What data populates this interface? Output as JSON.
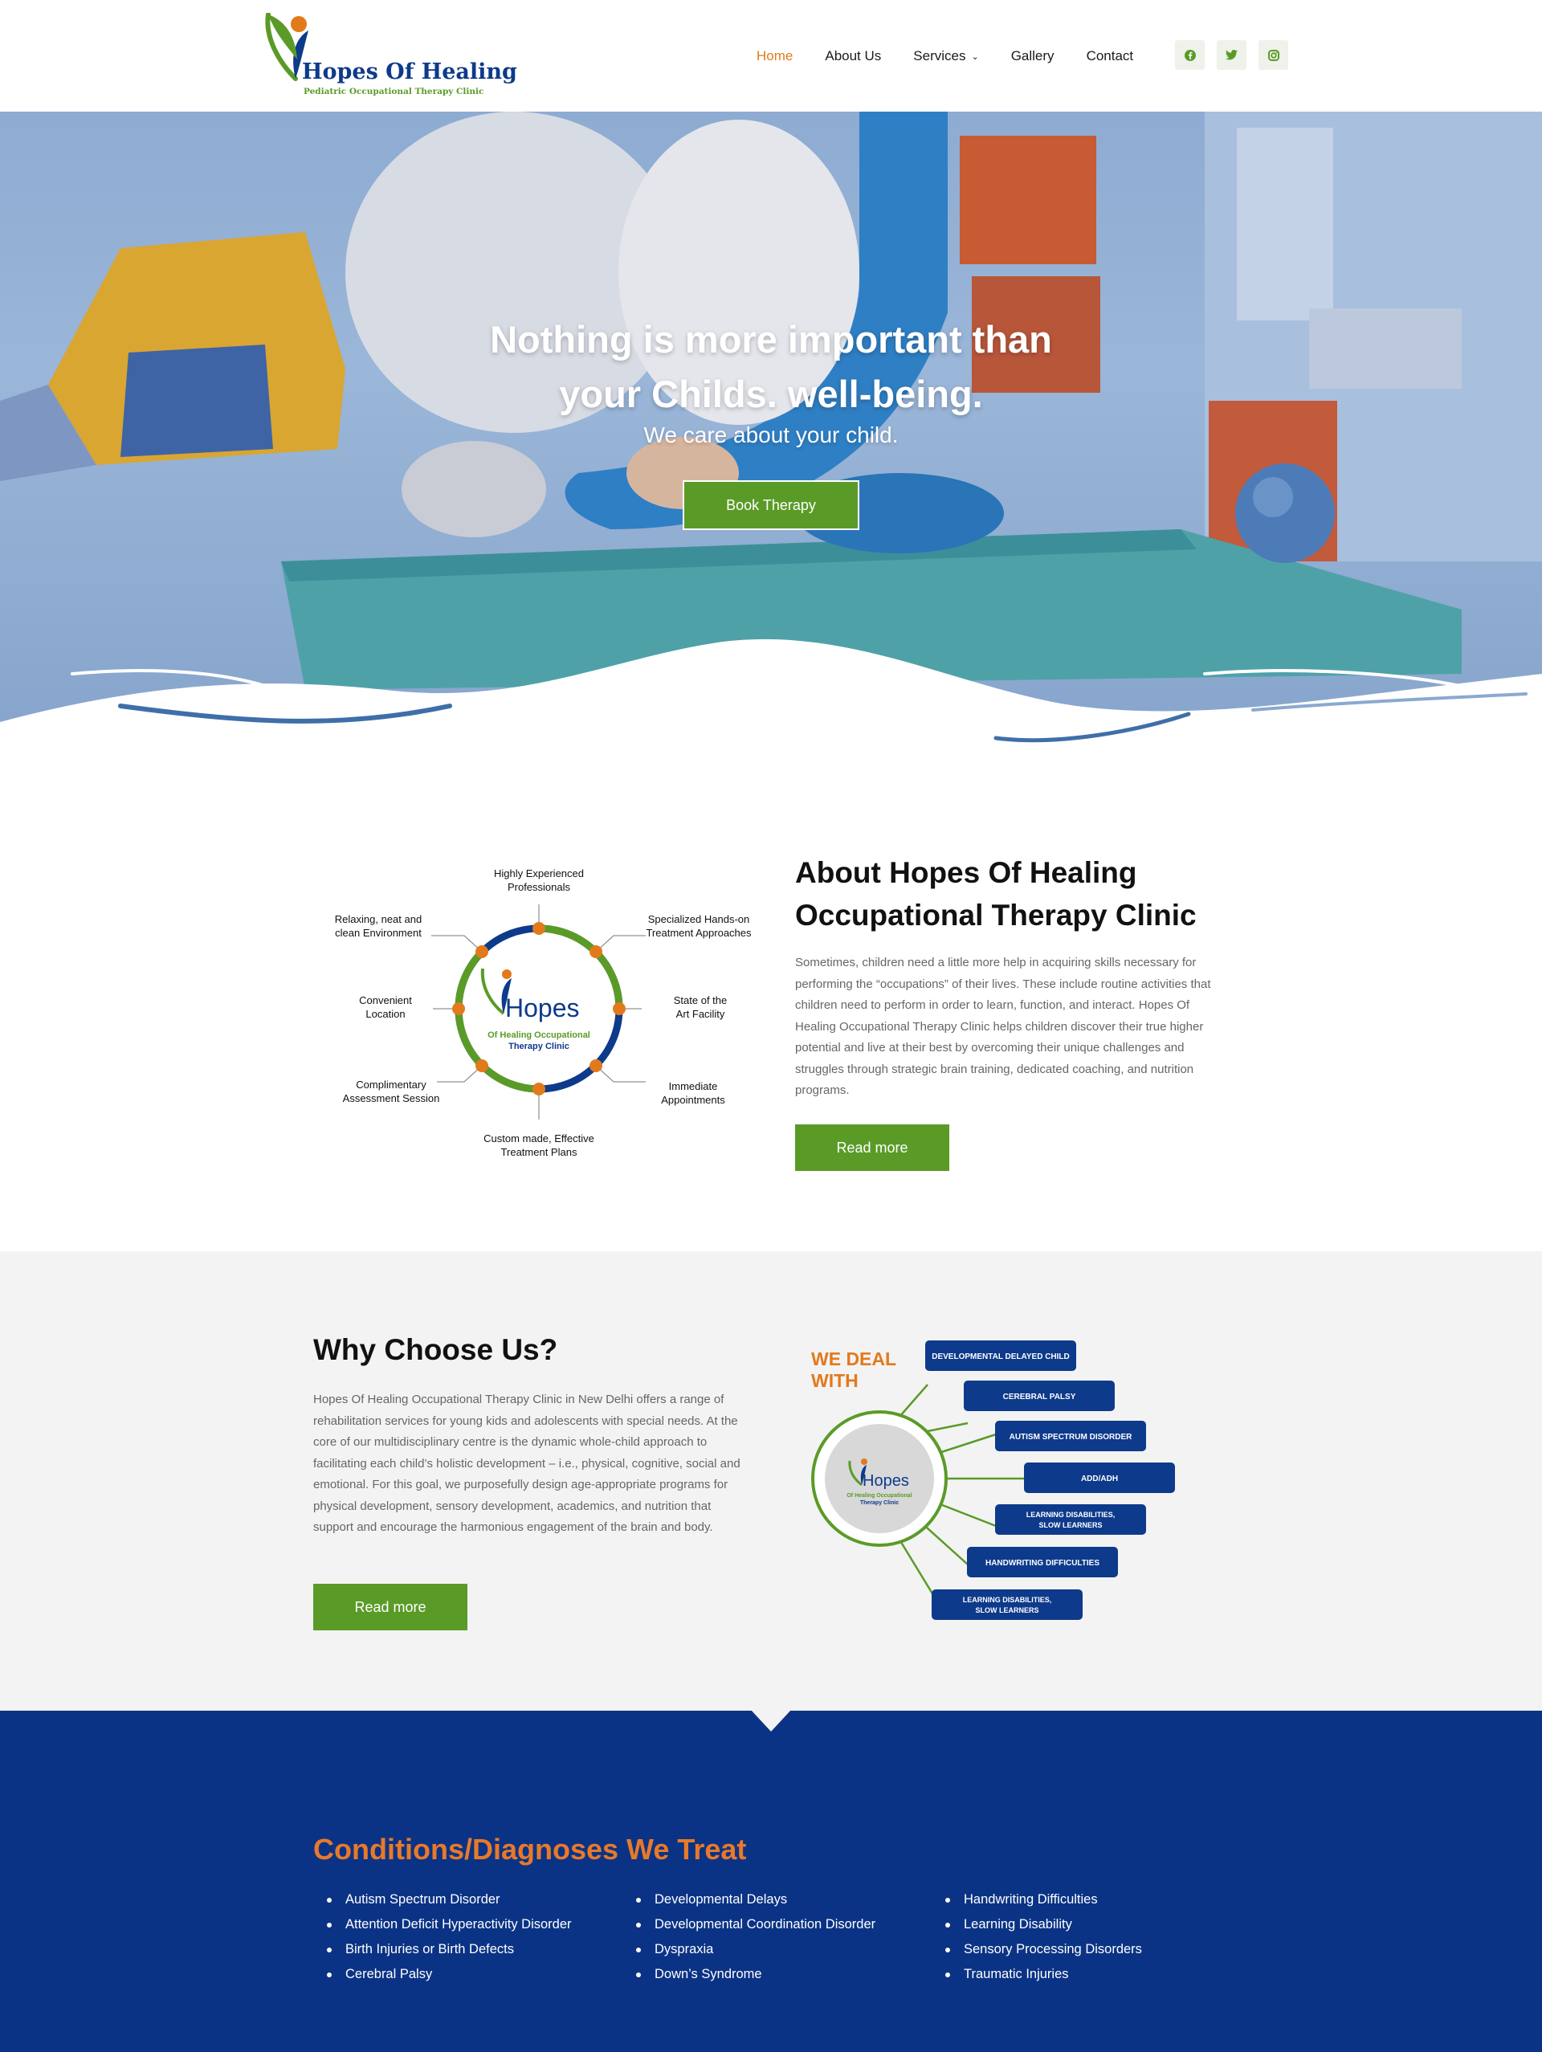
{
  "brand": {
    "name": "Hopes Of Healing",
    "tagline": "Pediatric Occupational Therapy Clinic"
  },
  "nav": {
    "items": [
      {
        "label": "Home",
        "active": true
      },
      {
        "label": "About Us"
      },
      {
        "label": "Services",
        "has_dropdown": true
      },
      {
        "label": "Gallery"
      },
      {
        "label": "Contact"
      }
    ],
    "social": [
      "facebook-icon",
      "twitter-icon",
      "instagram-icon"
    ]
  },
  "hero": {
    "title_line1": "Nothing is more important than",
    "title_line2": "your Childs. well-being.",
    "subtitle": "We care about your child.",
    "button": "Book Therapy"
  },
  "about": {
    "title_line1": "About Hopes Of Healing",
    "title_line2": "Occupational Therapy Clinic",
    "body": "Sometimes, children need a little more help in acquiring skills necessary for performing the “occupations” of their lives. These include routine activities that children need to perform in order to learn, function, and interact. Hopes Of Healing Occupational Therapy Clinic helps children discover their true higher potential and live at their best by overcoming their unique challenges and struggles through strategic brain training, dedicated coaching, and nutrition programs.",
    "button": "Read more",
    "diagram": {
      "center_name": "Hopes",
      "center_line2": "Of Healing Occupational",
      "center_line3": "Therapy Clinic",
      "labels": [
        [
          "Highly Experienced",
          "Professionals"
        ],
        [
          "Specialized Hands-on",
          "Treatment Approaches"
        ],
        [
          "State of the",
          "Art Facility"
        ],
        [
          "Immediate",
          "Appointments"
        ],
        [
          "Custom made, Effective",
          "Treatment Plans"
        ],
        [
          "Complimentary",
          "Assessment Session"
        ],
        [
          "Convenient",
          "Location"
        ],
        [
          "Relaxing, neat and",
          "clean Environment"
        ]
      ]
    }
  },
  "why": {
    "title": "Why Choose Us?",
    "body": "Hopes Of Healing Occupational Therapy Clinic in New Delhi offers a range of rehabilitation services for young kids and adolescents with special needs. At the core of our multidisciplinary centre is the dynamic whole-child approach to facilitating each child’s holistic development – i.e., physical, cognitive, social and emotional. For this goal, we purposefully design age-appropriate programs for physical development, sensory development, academics, and nutrition that support and encourage the harmonious engagement of the brain and body.",
    "button": "Read more",
    "deal": {
      "heading_line1": "WE DEAL",
      "heading_line2": "WITH",
      "center_name": "Hopes",
      "center_line2": "Of Healing Occupational",
      "center_line3": "Therapy Clinic",
      "items": [
        [
          "DEVELOPMENTAL DELAYED CHILD"
        ],
        [
          "CEREBRAL PALSY"
        ],
        [
          "AUTISM SPECTRUM DISORDER"
        ],
        [
          "ADD/ADH"
        ],
        [
          "LEARNING DISABILITIES,",
          "SLOW LEARNERS"
        ],
        [
          "HANDWRITING DIFFICULTIES"
        ],
        [
          "LEARNING DISABILITIES,",
          "SLOW LEARNERS"
        ]
      ]
    }
  },
  "conditions": {
    "title": "Conditions/Diagnoses We Treat",
    "columns": [
      [
        "Autism Spectrum Disorder",
        "Attention Deficit Hyperactivity Disorder",
        "Birth Injuries or Birth Defects",
        "Cerebral Palsy"
      ],
      [
        "Developmental Delays",
        "Developmental Coordination Disorder",
        "Dyspraxia",
        "Down’s Syndrome"
      ],
      [
        "Handwriting Difficulties",
        "Learning Disability",
        "Sensory Processing Disorders",
        "Traumatic Injuries"
      ]
    ]
  },
  "colors": {
    "accent_green": "#5a9b27",
    "accent_orange": "#e27a1c",
    "brand_blue": "#0b3385"
  }
}
